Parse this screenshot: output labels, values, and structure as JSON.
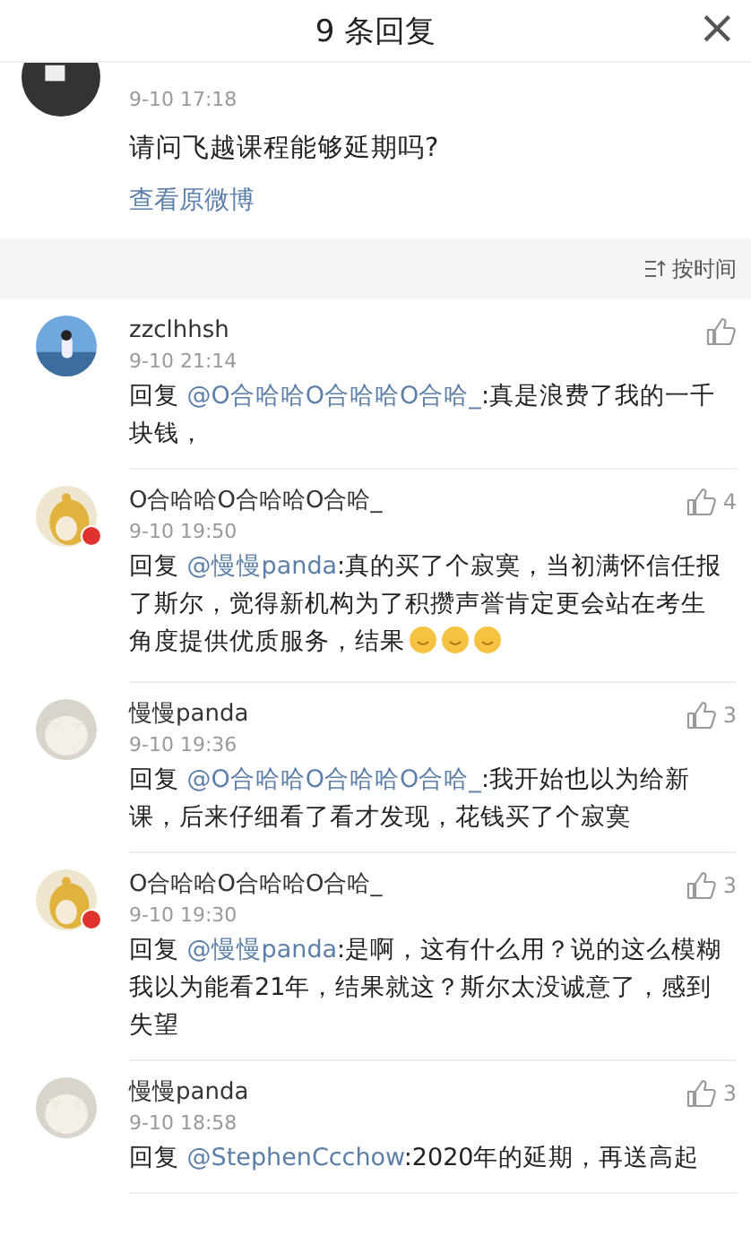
{
  "header": {
    "title": "9 条回复",
    "close": "×"
  },
  "original": {
    "time": "9-10 17:18",
    "text": "请问飞越课程能够延期吗?",
    "link": "查看原微博"
  },
  "sort": {
    "label": "按时间"
  },
  "comments": [
    {
      "name": "zzclhhsh",
      "time": "9-10 21:14",
      "badge": false,
      "reply": "回复",
      "mention": "@O合哈哈O合哈哈O合哈_",
      "text": ":真是浪费了我的一千块钱，"
    },
    {
      "name": "O合哈哈O合哈哈O合哈_",
      "time": "9-10 19:50",
      "likes": "4",
      "badge": true,
      "reply": "回复",
      "mention": "@慢慢panda",
      "text": ":真的买了个寂寞，当初满怀信任报了斯尔，觉得新机构为了积攒声誉肯定更会站在考生角度提供优质服务，结果",
      "emoji": [
        {
          "kind": "face"
        },
        {
          "kind": "face"
        },
        {
          "kind": "face"
        }
      ]
    },
    {
      "name": "慢慢panda",
      "time": "9-10 19:36",
      "likes": "3",
      "badge": false,
      "reply": "回复",
      "mention": "@O合哈哈O合哈哈O合哈_",
      "text": ":我开始也以为给新课，后来仔细看了看才发现，花钱买了个寂寞"
    },
    {
      "name": "O合哈哈O合哈哈O合哈_",
      "time": "9-10 19:30",
      "likes": "3",
      "badge": true,
      "reply": "回复",
      "mention": "@慢慢panda",
      "text": ":是啊，这有什么用？说的这么模糊我以为能看21年，结果就这？斯尔太没诚意了，感到失望"
    },
    {
      "name": "慢慢panda",
      "time": "9-10 18:58",
      "likes": "3",
      "badge": false,
      "reply": "回复",
      "mention": "@StephenCcchow",
      "text": ":2020年的延期，再送高起"
    }
  ]
}
